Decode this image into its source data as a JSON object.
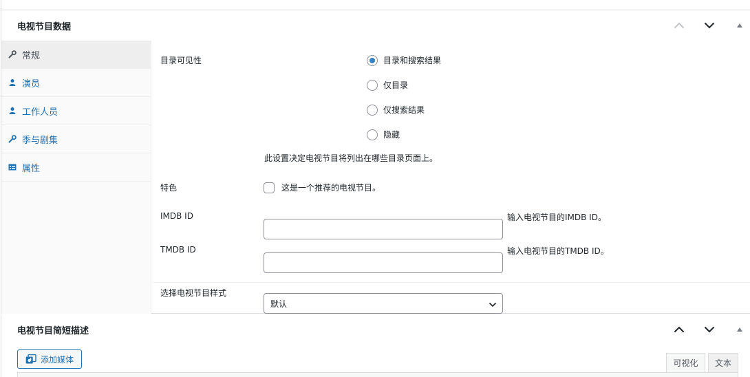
{
  "panel_tv_data": {
    "title": "电视节目数据",
    "tabs": [
      {
        "label": "常规",
        "icon": "wrench-icon",
        "active": true
      },
      {
        "label": "演员",
        "icon": "person-icon",
        "active": false
      },
      {
        "label": "工作人员",
        "icon": "person-icon",
        "active": false
      },
      {
        "label": "季与剧集",
        "icon": "wrench-icon",
        "active": false
      },
      {
        "label": "属性",
        "icon": "list-table-icon",
        "active": false
      }
    ],
    "catalog_visibility": {
      "label": "目录可见性",
      "options": [
        "目录和搜索结果",
        "仅目录",
        "仅搜索结果",
        "隐藏"
      ],
      "selected": "目录和搜索结果",
      "description": "此设置决定电视节目将列出在哪些目录页面上。"
    },
    "featured": {
      "label": "特色",
      "checkbox_label": "这是一个推荐的电视节目。",
      "checked": false
    },
    "imdb": {
      "label": "IMDB ID",
      "value": "",
      "hint": "输入电视节目的IMDB ID。"
    },
    "tmdb": {
      "label": "TMDB ID",
      "value": "",
      "hint": "输入电视节目的TMDB ID。"
    },
    "style": {
      "label": "选择电视节目样式",
      "selected": "默认"
    }
  },
  "panel_short_desc": {
    "title": "电视节目简短描述",
    "add_media_label": "添加媒体",
    "editor_tabs": {
      "visual": "可视化",
      "text": "文本"
    }
  },
  "colors": {
    "link": "#2271b1",
    "radio_checked": "#3582c4",
    "border": "#8c8f94"
  }
}
